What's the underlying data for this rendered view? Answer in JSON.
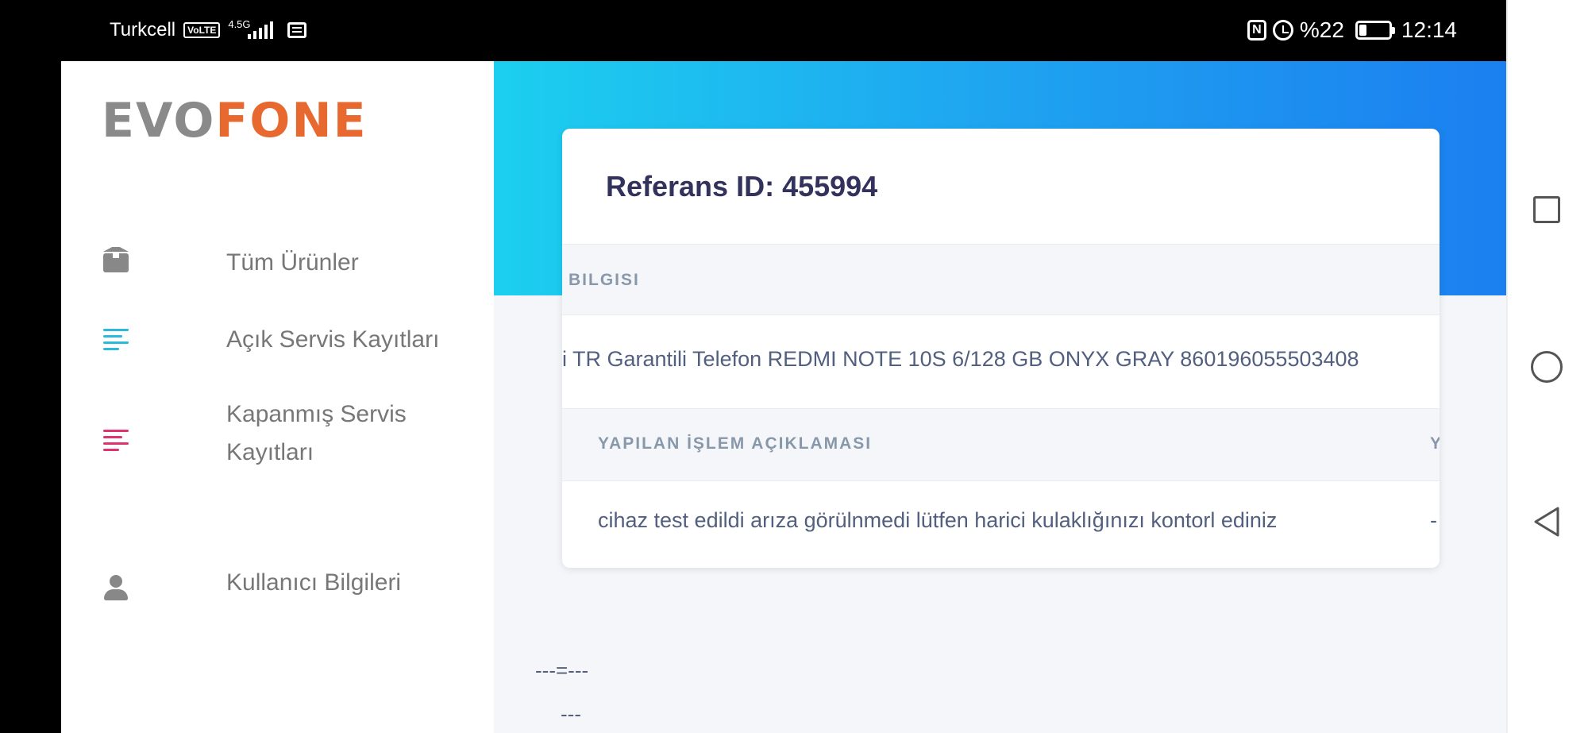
{
  "status_bar": {
    "carrier": "Turkcell",
    "volte": "VoLTE",
    "network": "4.5G",
    "battery_percent": "%22",
    "battery_level": 0.22,
    "time": "12:14",
    "nfc": "N"
  },
  "sidebar": {
    "logo_part1": "EVO",
    "logo_part2": "FONE",
    "items": [
      {
        "label": "Tüm Ürünler",
        "icon": "box-icon"
      },
      {
        "label": "Açık Servis Kayıtları",
        "icon": "list-icon",
        "color": "#2bbbd8"
      },
      {
        "label": "Kapanmış Servis Kayıtları",
        "icon": "list-icon",
        "color": "#e0326e"
      },
      {
        "label": "Kullanıcı Bilgileri",
        "icon": "user-icon"
      }
    ]
  },
  "card": {
    "title": "Referans ID: 455994",
    "section1_header": "BILGISI",
    "section1_value": "i TR Garantili Telefon REDMI NOTE 10S 6/128 GB ONYX GRAY 860196055503408",
    "section2_header": "YAPILAN İŞLEM AÇIKLAMASI",
    "section2_header_next": "Y",
    "section2_value": "cihaz test edildi arıza görülnmedi lütfen harici kulaklığınızı kontorl ediniz",
    "section2_value_next": "-"
  },
  "footer": {
    "line1": "---=---",
    "line2": "---"
  },
  "colors": {
    "banner_start": "#1ccfef",
    "banner_end": "#1b7ff0",
    "logo_gray": "#8a8a8a",
    "logo_orange": "#e8692f"
  }
}
